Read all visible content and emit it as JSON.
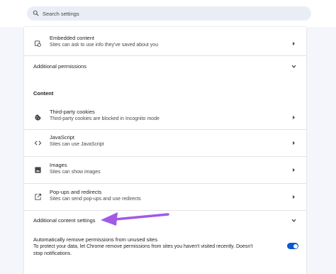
{
  "search": {
    "placeholder": "Search settings"
  },
  "rows": {
    "embedded": {
      "title": "Embedded content",
      "subtitle": "Sites can ask to use info they've saved about you"
    },
    "additional_permissions": {
      "label": "Additional permissions"
    },
    "content_header": "Content",
    "third_party": {
      "title": "Third-party cookies",
      "subtitle": "Third-party cookies are blocked in Incognito mode"
    },
    "javascript": {
      "title": "JavaScript",
      "subtitle": "Sites can use JavaScript"
    },
    "images": {
      "title": "Images",
      "subtitle": "Sites can show images"
    },
    "popups": {
      "title": "Pop-ups and redirects",
      "subtitle": "Sites can send pop-ups and use redirects"
    },
    "additional_content": {
      "label": "Additional content settings"
    },
    "auto_remove": {
      "title": "Automatically remove permissions from unused sites",
      "subtitle_line1": "To protect your data, let Chrome remove permissions from sites you haven't visited recently. Doesn't",
      "subtitle_line2": "stop notifications.",
      "enabled": true
    }
  },
  "colors": {
    "accent": "#0b57d0",
    "arrow": "#a259e6",
    "search_bg": "#e9eef6"
  },
  "icons": {
    "search": "search-icon",
    "embedded": "embedded-content-icon",
    "cookies": "cookie-icon",
    "javascript": "code-brackets-icon",
    "images": "image-icon",
    "popups": "open-external-icon"
  }
}
